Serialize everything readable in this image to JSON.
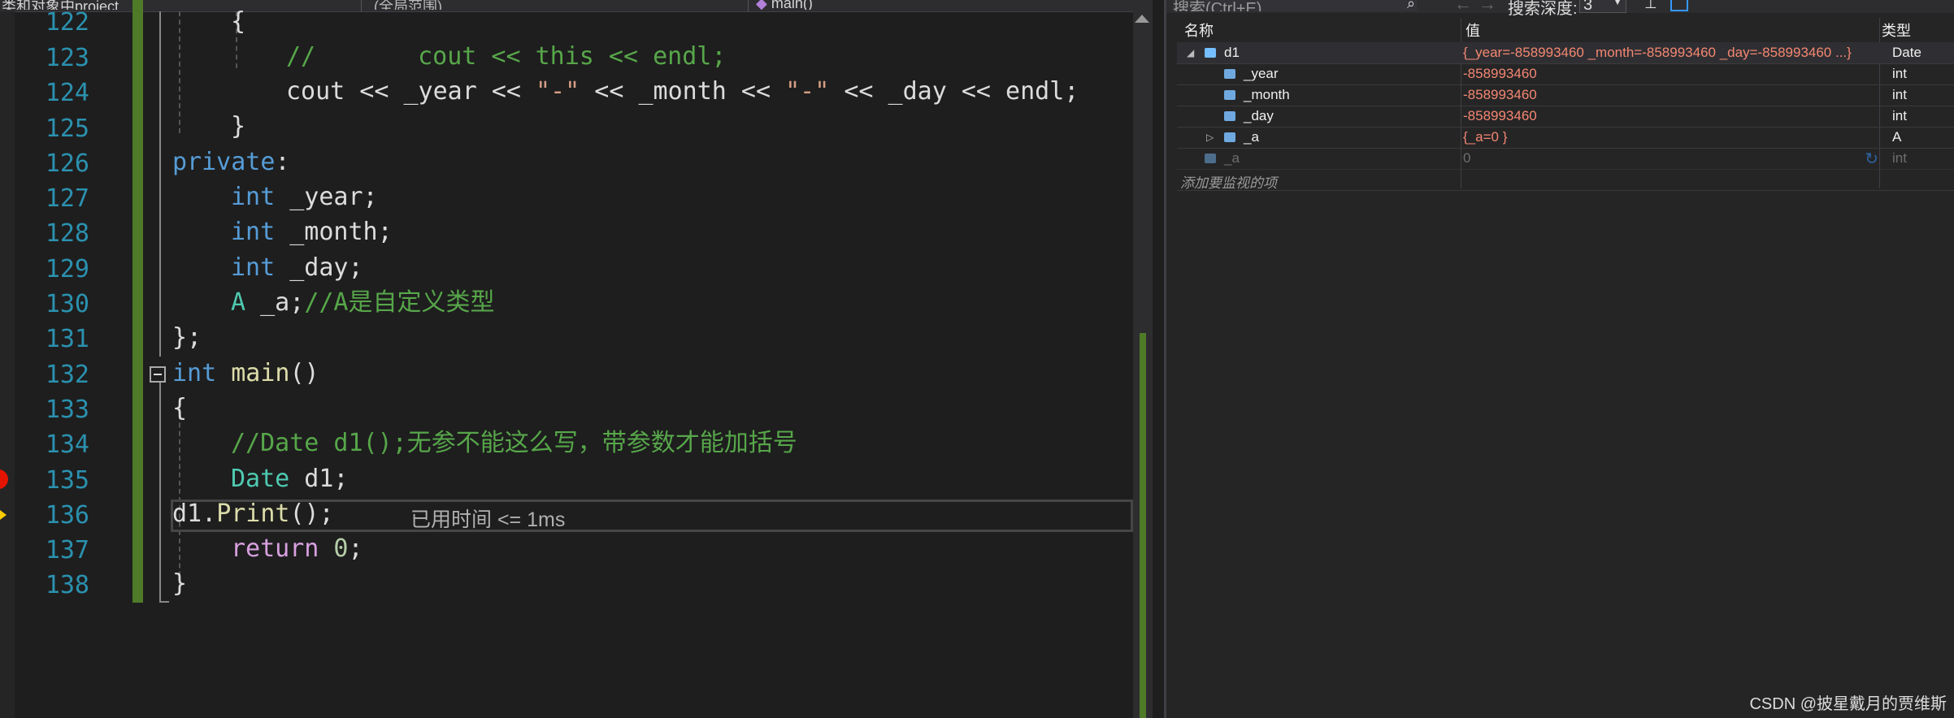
{
  "editor": {
    "nav": {
      "project": "类和对象中project",
      "scope": "(全局范围)",
      "function": "main()"
    },
    "line_numbers": [
      "122",
      "123",
      "124",
      "125",
      "126",
      "127",
      "128",
      "129",
      "130",
      "131",
      "132",
      "133",
      "134",
      "135",
      "136",
      "137",
      "138"
    ],
    "lines": {
      "l122": "{",
      "l123_a": "//",
      "l123_b": "cout << this << endl;",
      "l124_a": "cout << _year << ",
      "l124_s1": "\"-\"",
      "l124_b": " << _month << ",
      "l124_s2": "\"-\"",
      "l124_c": " << _day << endl;",
      "l125": "}",
      "l126_kw": "private",
      "l126_rest": ":",
      "l127_kw": "int",
      "l127_rest": " _year;",
      "l128_kw": "int",
      "l128_rest": " _month;",
      "l129_kw": "int",
      "l129_rest": " _day;",
      "l130_ty": "A",
      "l130_id": " _a;",
      "l130_cm": "//A是自定义类型",
      "l131": "};",
      "l132_kw": "int",
      "l132_fn": " main",
      "l132_rest": "()",
      "l133": "{",
      "l134_cm": "//Date d1();无参不能这么写，带参数才能加括号",
      "l135_ty": "Date",
      "l135_rest": " d1;",
      "l136_id": "d1.",
      "l136_fn": "Print",
      "l136_rest": "();",
      "l137_kw": "return",
      "l137_nm": " 0",
      "l137_rest": ";",
      "l138": "}"
    },
    "elapsed_hint": "已用时间 <= 1ms"
  },
  "watch": {
    "search_placeholder": "搜索(Ctrl+E)",
    "depth_label": "搜索深度:",
    "depth_value": "3",
    "headers": {
      "name": "名称",
      "value": "值",
      "type": "类型"
    },
    "rows": [
      {
        "name": "d1",
        "value": "{_year=-858993460 _month=-858993460 _day=-858993460 ...}",
        "type": "Date"
      },
      {
        "name": "_year",
        "value": "-858993460",
        "type": "int"
      },
      {
        "name": "_month",
        "value": "-858993460",
        "type": "int"
      },
      {
        "name": "_day",
        "value": "-858993460",
        "type": "int"
      },
      {
        "name": "_a",
        "value": "{_a=0 }",
        "type": "A"
      },
      {
        "name": "_a",
        "value": "0",
        "type": "int"
      }
    ],
    "add_item_placeholder": "添加要监视的项"
  },
  "watermark": "CSDN @披星戴月的贾维斯"
}
